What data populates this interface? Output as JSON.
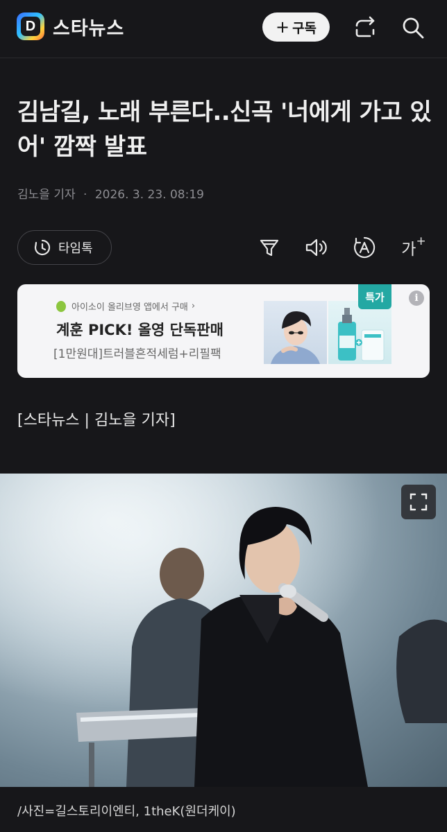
{
  "header": {
    "brand_logo_letter": "D",
    "brand_name": "스타뉴스",
    "subscribe_plus": "+",
    "subscribe_label": "구독",
    "icons": [
      "share-icon",
      "search-icon"
    ]
  },
  "article": {
    "headline": "김남길, 노래 부른다..신곡 '너에게 가고 있어' 깜짝 발표",
    "author": "김노을 기자",
    "separator": "·",
    "datetime": "2026. 3. 23. 08:19",
    "source_line": "[스타뉴스 | 김노을 기자]",
    "photo_caption": "/사진=길스토리이엔티, 1theK(원더케이)"
  },
  "toolbar": {
    "timetalk_label": "타임톡",
    "font_size_label": "가",
    "font_size_plus": "+",
    "icons": [
      "clock-icon",
      "filter-icon",
      "speaker-icon",
      "translate-icon",
      "font-size-icon"
    ]
  },
  "ad": {
    "store_line": "아이소이 올리브영 앱에서 구매",
    "chevron": "›",
    "title": "계훈 PICK! 올영 단독판매",
    "subtitle": "[1만원대]트러블흔적세럼+리필팩",
    "badge": "특가",
    "info": "i"
  },
  "colors": {
    "background": "#17171a",
    "ad_background": "#f5f5f7",
    "badge": "#23a8a3",
    "text_primary": "#f0f0f0",
    "text_muted": "#8d8d92"
  }
}
